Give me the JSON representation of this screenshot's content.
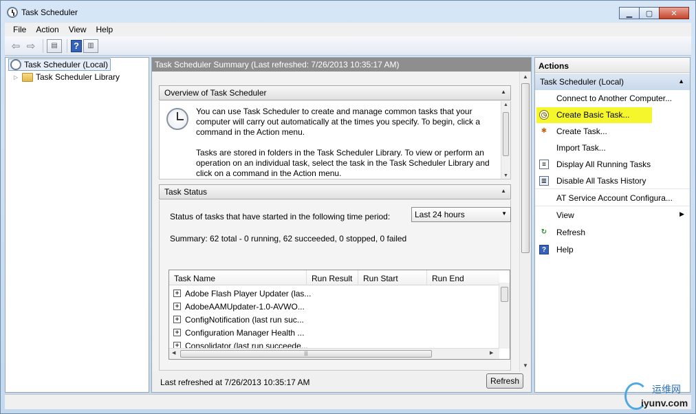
{
  "window": {
    "title": "Task Scheduler"
  },
  "menu": [
    "File",
    "Action",
    "View",
    "Help"
  ],
  "tree": {
    "root": "Task Scheduler (Local)",
    "child": "Task Scheduler Library"
  },
  "center": {
    "header": "Task Scheduler Summary (Last refreshed: 7/26/2013 10:35:17 AM)",
    "overview": {
      "title": "Overview of Task Scheduler",
      "para1": "You can use Task Scheduler to create and manage common tasks that your computer will carry out automatically at the times you specify. To begin, click a command in the Action menu.",
      "para2": "Tasks are stored in folders in the Task Scheduler Library. To view or perform an operation on an individual task, select the task in the Task Scheduler Library and click on a command in the Action menu."
    },
    "status": {
      "title": "Task Status",
      "period_label": "Status of tasks that have started in the following time period:",
      "period_value": "Last 24 hours",
      "summary": "Summary: 62 total - 0 running, 62 succeeded, 0 stopped, 0 failed",
      "columns": [
        "Task Name",
        "Run Result",
        "Run Start",
        "Run End"
      ],
      "rows": [
        "Adobe Flash Player Updater (las...",
        "AdobeAAMUpdater-1.0-AVWO...",
        "ConfigNotification (last run suc...",
        "Configuration Manager Health ...",
        "Consolidator (last run succeede..."
      ]
    },
    "footer": {
      "text": "Last refreshed at 7/26/2013 10:35:17 AM",
      "refresh": "Refresh"
    }
  },
  "actions": {
    "title": "Actions",
    "group": "Task Scheduler (Local)",
    "items": [
      "Connect to Another Computer...",
      "Create Basic Task...",
      "Create Task...",
      "Import Task...",
      "Display All Running Tasks",
      "Disable All Tasks History",
      "AT Service Account Configura...",
      "View",
      "Refresh",
      "Help"
    ],
    "highlight_color": "#f6f62c"
  },
  "watermark": {
    "cn": "运维网",
    "en": "iyunv.com"
  }
}
